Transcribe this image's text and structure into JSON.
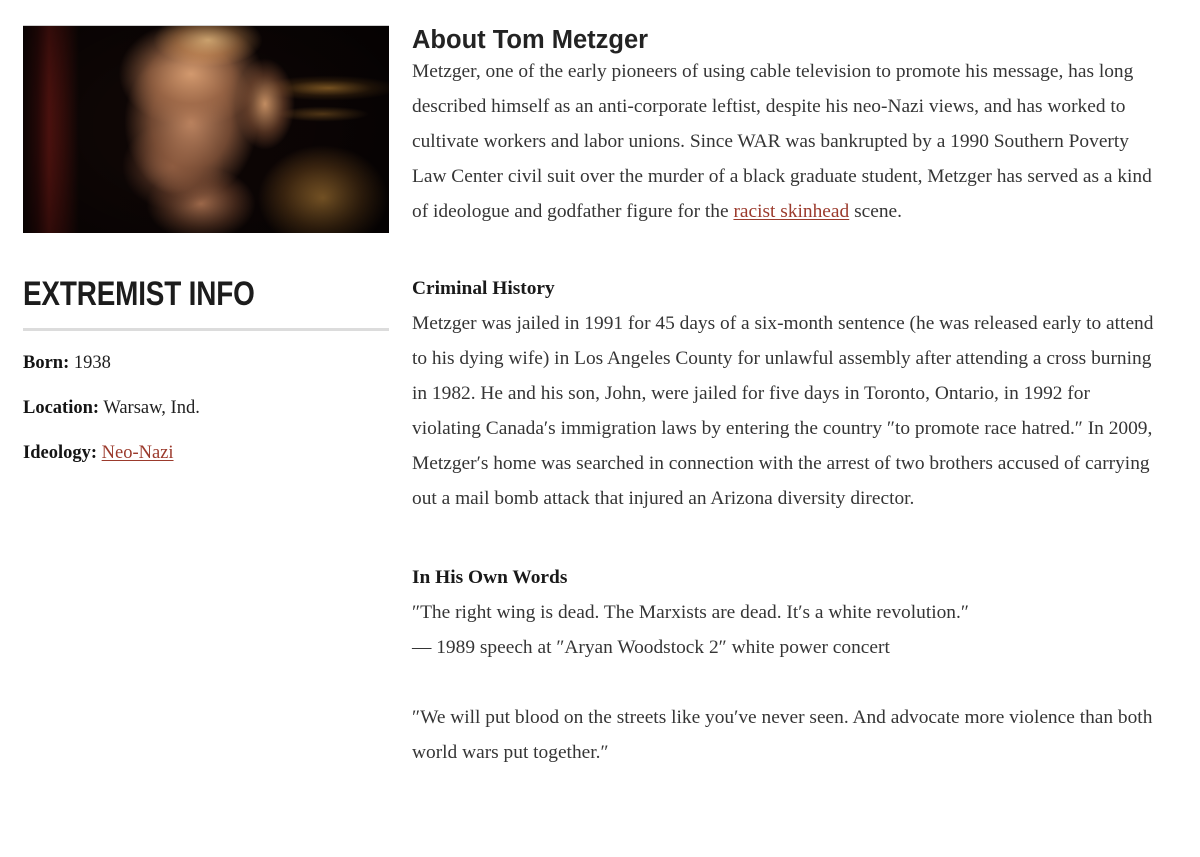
{
  "profile": {
    "photo_alt": "portrait-photo-of-tom-metzger",
    "info_heading": "EXTREMIST INFO",
    "fields": [
      {
        "label": "Born:",
        "value": "1938",
        "is_link": false
      },
      {
        "label": "Location:",
        "value": "Warsaw, Ind.",
        "is_link": false
      },
      {
        "label": "Ideology:",
        "value": "Neo-Nazi",
        "is_link": true
      }
    ]
  },
  "main": {
    "title": "About Tom Metzger",
    "intro_before_link": "Metzger, one of the early pioneers of using cable television to promote his message, has long described himself as an anti-corporate leftist, despite his neo-Nazi views, and has worked to cultivate workers and labor unions. Since WAR was bankrupted by a 1990 Southern Poverty Law Center civil suit over the murder of a black graduate student, Metzger has served as a kind of ideologue and godfather figure for the ",
    "intro_link": "racist skinhead",
    "intro_after_link": " scene.",
    "criminal_history": {
      "heading": "Criminal History",
      "text": "Metzger was jailed in 1991 for 45 days of a six-month sentence (he was released early to attend to his dying wife) in Los Angeles County for unlawful assembly after attending a cross burning in 1982. He and his son, John, were jailed for five days in Toronto, Ontario, in 1992 for violating Canada′s immigration laws by entering the country ″to promote race hatred.″ In 2009, Metzger′s home was searched in connection with the arrest of two brothers accused of carrying out a mail bomb attack that injured an Arizona diversity director."
    },
    "own_words": {
      "heading": "In His Own Words",
      "quotes": [
        {
          "text": "″The right wing is dead. The Marxists are dead. It′s a white revolution.″",
          "attribution": "— 1989 speech at ″Aryan Woodstock 2″ white power concert"
        },
        {
          "text": "″We will put blood on the streets like you′ve never seen. And advocate more violence than both world wars put together.″",
          "attribution": ""
        }
      ]
    }
  },
  "colors": {
    "link": "#9b3a2c",
    "body_text": "#353535",
    "heading": "#1c1c1c",
    "divider": "#dcdcdc",
    "page_background": "#ffffff"
  }
}
